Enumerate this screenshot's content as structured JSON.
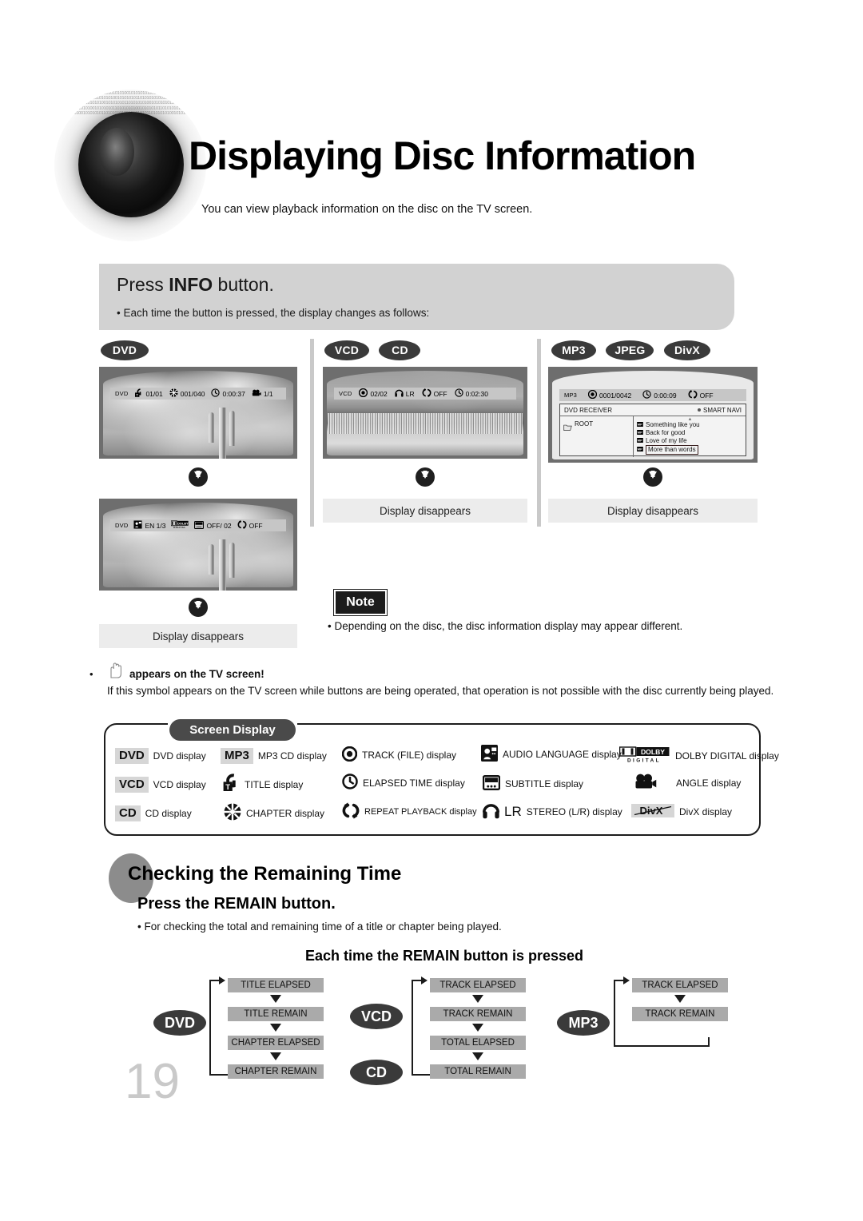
{
  "header": {
    "title": "Displaying Disc Information",
    "subtitle": "You can view playback information on the disc on the TV screen.",
    "disc_icon": "disc-graphic"
  },
  "info_section": {
    "heading_prefix": "Press ",
    "heading_strong": "INFO",
    "heading_suffix": " button.",
    "bullet": "• Each time the button is pressed, the display changes as follows:"
  },
  "columns": [
    {
      "badges": [
        "DVD"
      ],
      "screens": [
        {
          "type": "dvd-cactus",
          "osd": [
            {
              "label": "DVD",
              "icon": "",
              "value": ""
            },
            {
              "label": "",
              "icon": "title-icon",
              "value": "01/01"
            },
            {
              "label": "",
              "icon": "chapter-icon",
              "value": "001/040"
            },
            {
              "label": "",
              "icon": "elapsed-time-icon",
              "value": "0:00:37"
            },
            {
              "label": "",
              "icon": "angle-icon",
              "value": "1/1"
            }
          ]
        },
        {
          "type": "dvd-cactus",
          "osd": [
            {
              "label": "DVD",
              "icon": "",
              "value": ""
            },
            {
              "label": "",
              "icon": "audio-language-icon",
              "value": "EN 1/3"
            },
            {
              "label": "",
              "icon": "dolby-digital-icon",
              "value": ""
            },
            {
              "label": "",
              "icon": "subtitle-icon",
              "value": "OFF/ 02"
            },
            {
              "label": "",
              "icon": "repeat-icon",
              "value": "OFF"
            }
          ]
        }
      ],
      "disappear_label": "Display disappears"
    },
    {
      "badges": [
        "VCD",
        "CD"
      ],
      "screens": [
        {
          "type": "beach",
          "osd": [
            {
              "label": "VCD",
              "icon": "",
              "value": ""
            },
            {
              "label": "",
              "icon": "track-icon",
              "value": "02/02"
            },
            {
              "label": "",
              "icon": "stereo-icon",
              "value": "LR"
            },
            {
              "label": "",
              "icon": "repeat-icon",
              "value": "OFF"
            },
            {
              "label": "",
              "icon": "elapsed-time-icon",
              "value": "0:02:30"
            }
          ]
        }
      ],
      "disappear_label": "Display disappears"
    },
    {
      "badges": [
        "MP3",
        "JPEG",
        "DivX"
      ],
      "screens": [
        {
          "type": "mp3-navi",
          "osd": [
            {
              "label": "MP3",
              "icon": "",
              "value": ""
            },
            {
              "label": "",
              "icon": "track-icon",
              "value": "0001/0042"
            },
            {
              "label": "",
              "icon": "elapsed-time-icon",
              "value": "0:00:09"
            },
            {
              "label": "",
              "icon": "repeat-icon",
              "value": "OFF"
            }
          ],
          "navi": {
            "device": "DVD RECEIVER",
            "mode": "SMART NAVI",
            "root": "ROOT",
            "tracks": [
              "Something like you",
              "Back for good",
              "Love of my life",
              "More than words"
            ],
            "selected_index": 3
          }
        }
      ],
      "disappear_label": "Display disappears"
    }
  ],
  "note": {
    "tag": "Note",
    "text": "• Depending on the disc, the disc information display may appear different."
  },
  "hand_symbol": {
    "bullet": "•",
    "icon": "hand-prohibited-icon",
    "heading": "appears on the TV screen!",
    "body": "If this symbol appears on the TV screen while buttons are being operated, that operation is not possible with the disc currently being played."
  },
  "legend": {
    "title": "Screen Display",
    "items": [
      {
        "icon": "dvd-tag",
        "tag": "DVD",
        "label": "DVD display"
      },
      {
        "icon": "vcd-tag",
        "tag": "VCD",
        "label": "VCD display"
      },
      {
        "icon": "cd-tag",
        "tag": "CD",
        "label": "CD display"
      },
      {
        "icon": "mp3-tag",
        "tag": "MP3",
        "label": "MP3 CD display"
      },
      {
        "icon": "title-icon",
        "tag": "",
        "label": "TITLE display"
      },
      {
        "icon": "chapter-icon",
        "tag": "",
        "label": "CHAPTER display"
      },
      {
        "icon": "track-icon",
        "tag": "",
        "label": "TRACK (FILE) display"
      },
      {
        "icon": "elapsed-time-icon",
        "tag": "",
        "label": "ELAPSED TIME display"
      },
      {
        "icon": "repeat-icon",
        "tag": "",
        "label": "REPEAT PLAYBACK display"
      },
      {
        "icon": "audio-language-icon",
        "tag": "",
        "label": "AUDIO LANGUAGE display"
      },
      {
        "icon": "subtitle-icon",
        "tag": "",
        "label": "SUBTITLE display"
      },
      {
        "icon": "stereo-icon",
        "tag": "LR",
        "label": "STEREO (L/R) display"
      },
      {
        "icon": "dolby-digital-icon",
        "tag": "DOLBY DIGITAL",
        "label": "DOLBY DIGITAL display"
      },
      {
        "icon": "angle-icon",
        "tag": "",
        "label": "ANGLE display"
      },
      {
        "icon": "divx-icon",
        "tag": "DivX",
        "label": "DivX display"
      }
    ]
  },
  "remaining_time": {
    "section_title": "Checking the Remaining Time",
    "press_label": "Press the REMAIN button.",
    "bullet": "• For checking the total and remaining time of a title or chapter being played.",
    "each_time_label": "Each time the REMAIN button is pressed",
    "flows": [
      {
        "badges": [
          "DVD"
        ],
        "steps": [
          "TITLE ELAPSED",
          "TITLE REMAIN",
          "CHAPTER ELAPSED",
          "CHAPTER REMAIN"
        ]
      },
      {
        "badges": [
          "VCD",
          "CD"
        ],
        "steps": [
          "TRACK ELAPSED",
          "TRACK REMAIN",
          "TOTAL ELAPSED",
          "TOTAL REMAIN"
        ]
      },
      {
        "badges": [
          "MP3"
        ],
        "steps": [
          "TRACK ELAPSED",
          "TRACK REMAIN"
        ]
      }
    ]
  },
  "page_number": "19",
  "colors": {
    "banner_bg": "#d2d2d2",
    "badge_bg": "#3a3a3a",
    "step_bg": "#aaaaaa",
    "disappear_bg": "#ececec",
    "page_number": "#c9c9c9"
  }
}
